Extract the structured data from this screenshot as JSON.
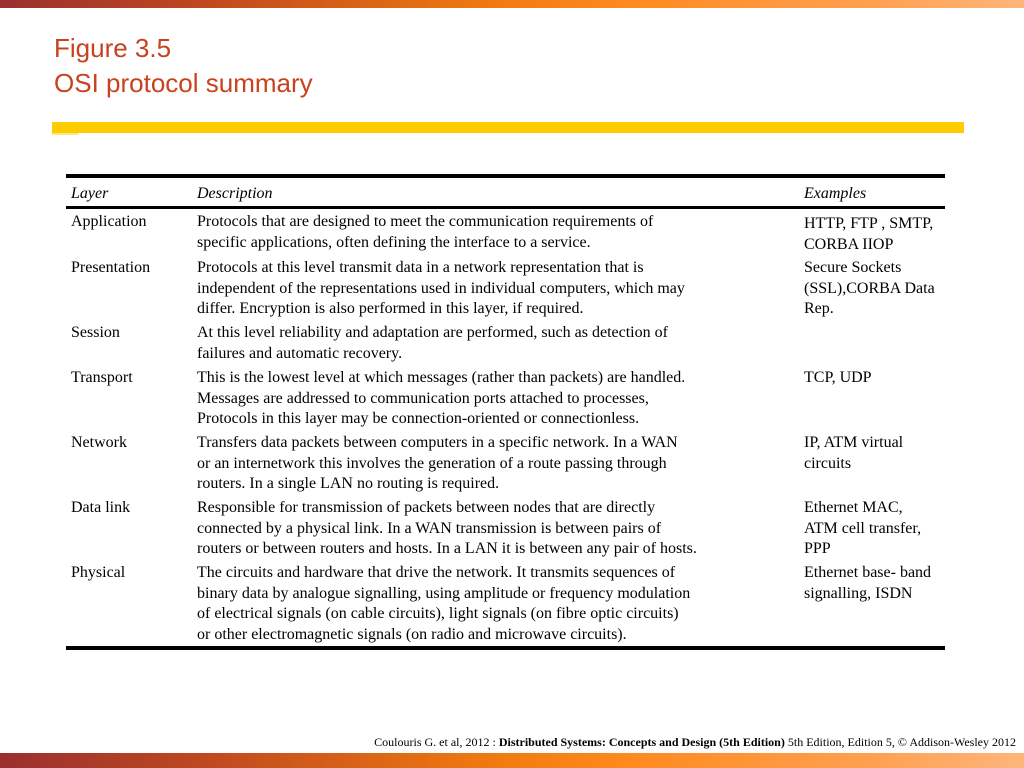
{
  "slide": {
    "title_line1": "Figure 3.5",
    "title_line2": "OSI protocol summary",
    "colors": {
      "title": "#c8421e",
      "accent_rule": "#ffcc00",
      "gradient_start": "#9a2f2f",
      "gradient_mid": "#ff8a20",
      "gradient_end": "#ffb57a"
    }
  },
  "table": {
    "headers": {
      "layer": "Layer",
      "description": "Description",
      "examples": "Examples"
    },
    "rows": [
      {
        "layer": "Application",
        "description": [
          "Protocols that are designed to meet the communication requirements of",
          "specific applications, often defining the interface to a service."
        ],
        "examples": [
          "HTTP, FTP , SMTP,",
          "CORBA IIOP"
        ]
      },
      {
        "layer": "Presentation",
        "description": [
          "Protocols at this level transmit data in a network representation that is",
          "independent of the representations used in individual computers, which may",
          "differ. Encryption is also performed in this layer, if required."
        ],
        "examples": [
          "Secure Sockets",
          "(SSL),CORBA Data",
          "Rep."
        ]
      },
      {
        "layer": "Session",
        "description": [
          "At this level reliability and adaptation are performed, such as detection of",
          "failures and automatic recovery."
        ],
        "examples": []
      },
      {
        "layer": "Transport",
        "description": [
          "This is the lowest level at which messages (rather than packets) are handled.",
          "Messages are addressed to communication ports attached to processes,",
          "Protocols in this layer may be connection-oriented or connectionless."
        ],
        "examples": [
          "TCP, UDP"
        ]
      },
      {
        "layer": "Network",
        "description": [
          "Transfers data packets between computers in a specific network. In a WAN",
          "or an internetwork this involves the generation of a route passing through",
          "routers. In a single LAN no routing is required."
        ],
        "examples": [
          "IP,  ATM virtual",
          "circuits"
        ]
      },
      {
        "layer": "Data link",
        "description": [
          "Responsible for transmission of packets between nodes that are directly",
          "connected by a physical link. In a WAN transmission is between pairs of",
          "routers or between routers and hosts. In a LAN it is between any pair of hosts."
        ],
        "examples": [
          "Ethernet MAC,",
          "ATM cell transfer,",
          "PPP"
        ]
      },
      {
        "layer": "Physical",
        "description": [
          "The circuits and hardware that drive the network. It transmits sequences of",
          "binary data by analogue signalling, using amplitude or frequency modulation",
          "of electrical signals (on cable circuits), light signals (on fibre optic circuits)",
          "or other electromagnetic signals (on radio and microwave circuits)."
        ],
        "examples": [
          "Ethernet base- band",
          "signalling,    ISDN"
        ]
      }
    ]
  },
  "footer": {
    "prefix": "Coulouris G. et al, 2012 : ",
    "book_title": "Distributed Systems: Concepts and Design (5th Edition)",
    "suffix": " 5th Edition, Edition 5, © Addison-Wesley 2012"
  }
}
